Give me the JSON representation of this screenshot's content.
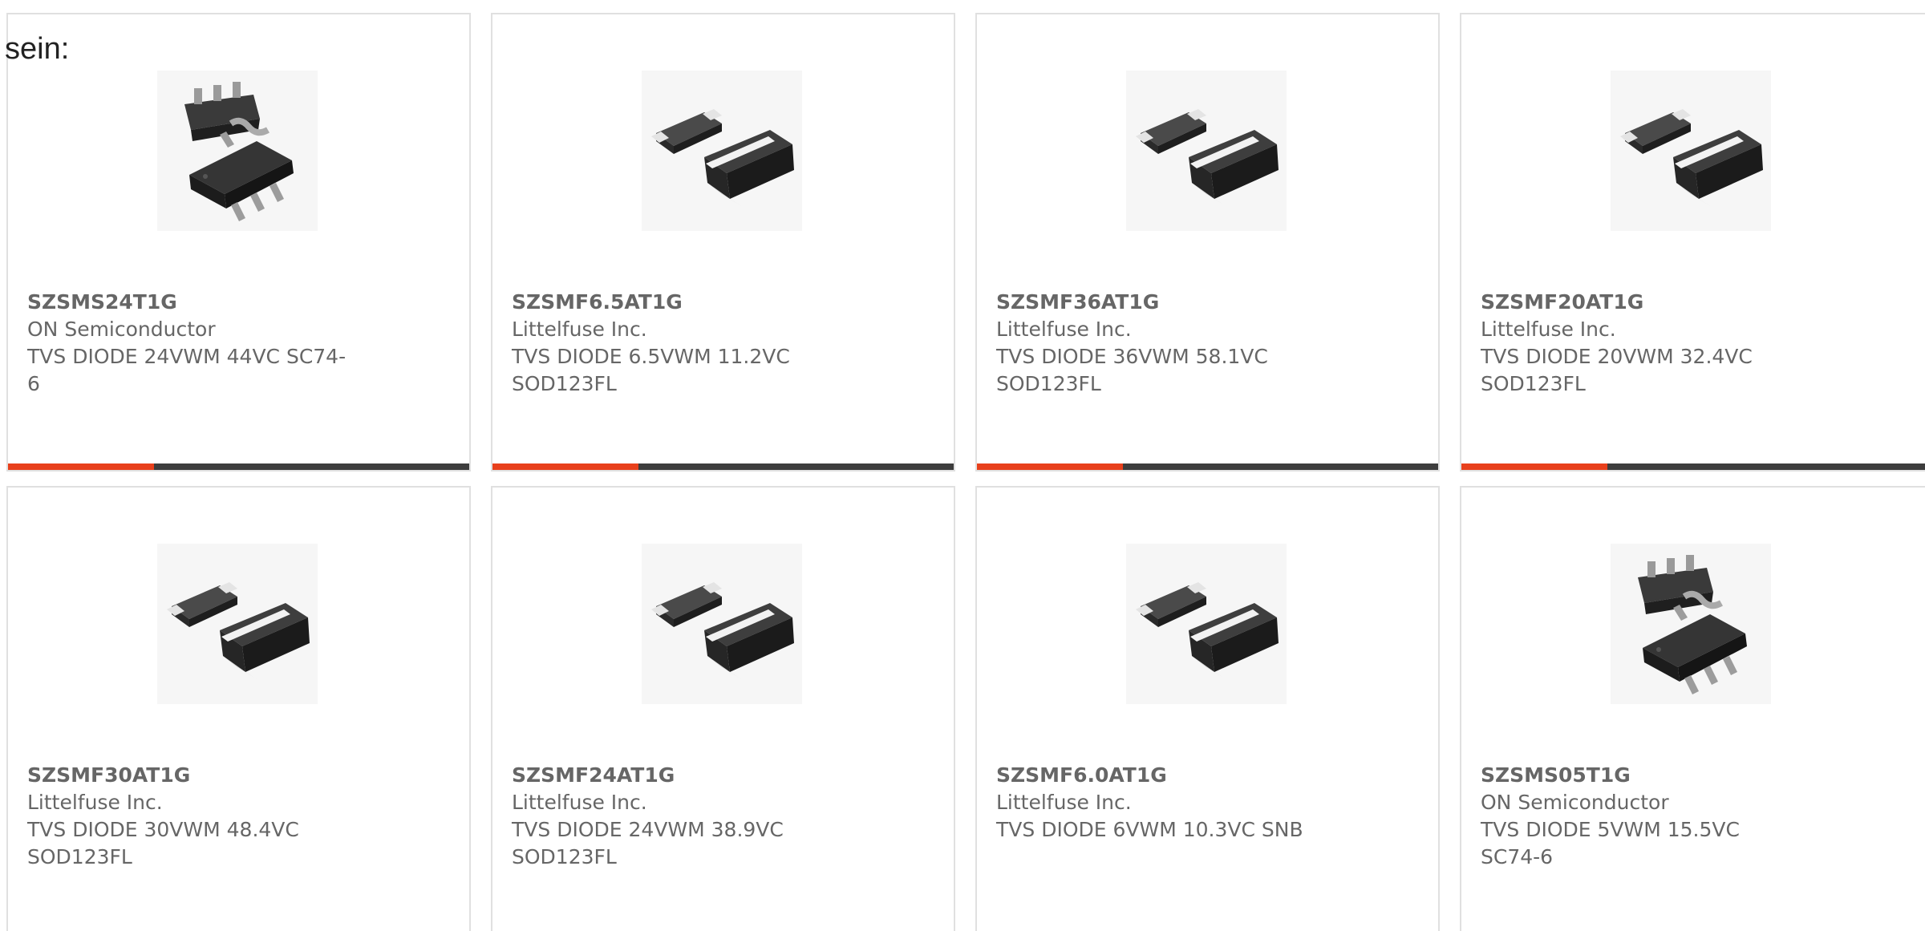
{
  "intro_text": "sein:",
  "colors": {
    "accent": "#e8401c",
    "bar": "#3d3d3d",
    "text": "#666666",
    "border": "#e0e0e0"
  },
  "products": [
    {
      "part": "SZSMS24T1G",
      "maker": "ON Semiconductor",
      "description": "TVS DIODE 24VWM 44VC SC74-6",
      "package_icon": "sc74-6-package-image"
    },
    {
      "part": "SZSMF6.5AT1G",
      "maker": "Littelfuse Inc.",
      "description": "TVS DIODE 6.5VWM 11.2VC SOD123FL",
      "package_icon": "sod123fl-package-image"
    },
    {
      "part": "SZSMF36AT1G",
      "maker": "Littelfuse Inc.",
      "description": "TVS DIODE 36VWM 58.1VC SOD123FL",
      "package_icon": "sod123fl-package-image"
    },
    {
      "part": "SZSMF20AT1G",
      "maker": "Littelfuse Inc.",
      "description": "TVS DIODE 20VWM 32.4VC SOD123FL",
      "package_icon": "sod123fl-package-image"
    },
    {
      "part": "SZSMF30AT1G",
      "maker": "Littelfuse Inc.",
      "description": "TVS DIODE 30VWM 48.4VC SOD123FL",
      "package_icon": "sod123fl-package-image"
    },
    {
      "part": "SZSMF24AT1G",
      "maker": "Littelfuse Inc.",
      "description": "TVS DIODE 24VWM 38.9VC SOD123FL",
      "package_icon": "sod123fl-package-image"
    },
    {
      "part": "SZSMF6.0AT1G",
      "maker": "Littelfuse Inc.",
      "description": "TVS DIODE 6VWM 10.3VC SNB",
      "package_icon": "sod123fl-package-image"
    },
    {
      "part": "SZSMS05T1G",
      "maker": "ON Semiconductor",
      "description": "TVS DIODE 5VWM 15.5VC SC74-6",
      "package_icon": "sc74-6-package-image"
    }
  ]
}
